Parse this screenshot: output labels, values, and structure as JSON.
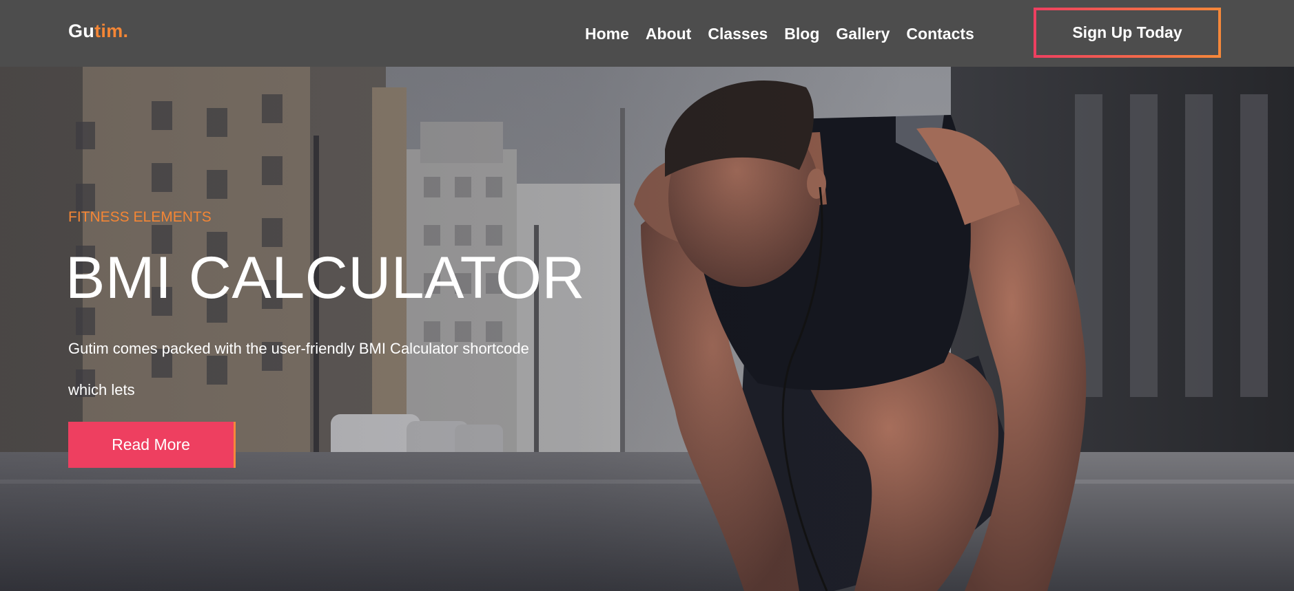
{
  "brand": {
    "name_main": "Gu",
    "name_accent": "tim."
  },
  "nav": {
    "items": [
      {
        "label": "Home"
      },
      {
        "label": "About"
      },
      {
        "label": "Classes"
      },
      {
        "label": "Blog"
      },
      {
        "label": "Gallery"
      },
      {
        "label": "Contacts"
      }
    ],
    "signup_label": "Sign Up Today"
  },
  "hero": {
    "eyebrow": "FITNESS ELEMENTS",
    "title": "BMI CALCULATOR",
    "description": "Gutim comes packed with the user-friendly BMI Calculator shortcode which lets",
    "button_label": "Read More"
  },
  "colors": {
    "accent_orange": "#f58635",
    "accent_pink": "#ee3f60",
    "header_bg": "#4d4d4d"
  }
}
